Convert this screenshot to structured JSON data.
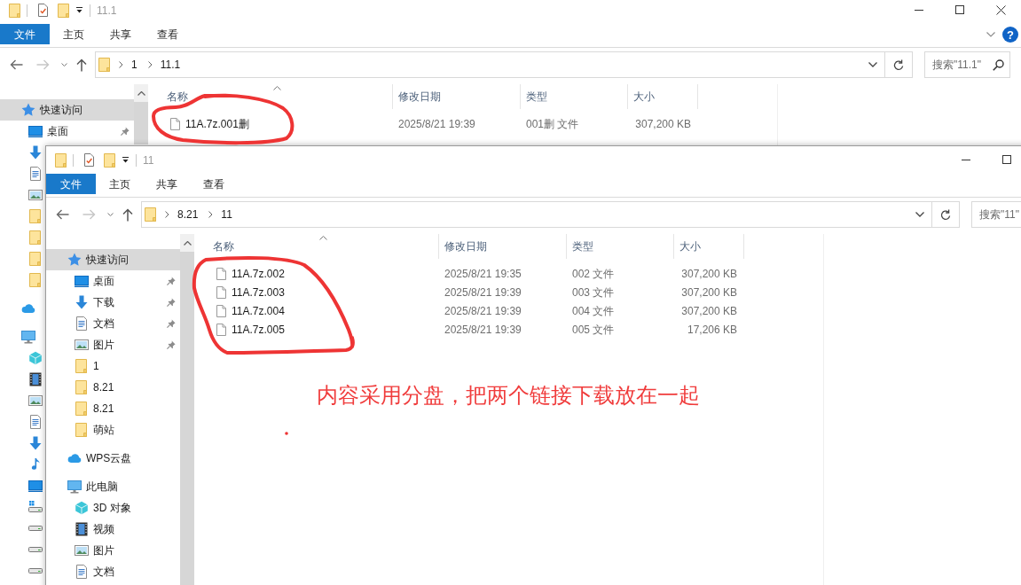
{
  "windows": [
    {
      "title": "11.1",
      "window_buttons": [
        {
          "kind": "minimize"
        },
        {
          "kind": "maximize"
        },
        {
          "kind": "close"
        }
      ],
      "ribbon_tabs": [
        {
          "label": "文件",
          "kind": "file_menu"
        },
        {
          "label": "主页",
          "kind": "tab"
        },
        {
          "label": "共享",
          "kind": "tab"
        },
        {
          "label": "查看",
          "kind": "tab"
        }
      ],
      "ribbon_toggle": true,
      "help_button": {
        "label": "?"
      },
      "navigation_buttons": [
        {
          "kind": "back",
          "disabled": false
        },
        {
          "kind": "forward",
          "disabled": true
        },
        {
          "kind": "recent_locations"
        },
        {
          "kind": "up",
          "disabled": false
        }
      ],
      "breadcrumb": [
        "1",
        "11.1"
      ],
      "search": {
        "placeholder": "搜索\"11.1\"",
        "icon_visible": true
      },
      "navigation_pane": [
        {
          "kind": "quick_access",
          "label": "快速访问",
          "selected": true,
          "children": [
            {
              "kind": "desktop",
              "label": "桌面",
              "selected": false,
              "pinned": true
            },
            {
              "kind": "downloads",
              "selected": false
            },
            {
              "kind": "documents",
              "selected": false
            },
            {
              "kind": "pictures",
              "selected": false
            },
            {
              "kind": "folder",
              "selected": false
            },
            {
              "kind": "folder",
              "selected": false
            },
            {
              "kind": "folder",
              "selected": false
            },
            {
              "kind": "folder",
              "selected": false
            }
          ]
        },
        {
          "kind": "wps_cloud",
          "selected": false
        },
        {
          "kind": "this_pc",
          "selected": false,
          "children": [
            {
              "kind": "objects_3d",
              "selected": false
            },
            {
              "kind": "videos",
              "selected": false
            },
            {
              "kind": "pictures",
              "selected": false
            },
            {
              "kind": "documents",
              "selected": false
            },
            {
              "kind": "downloads",
              "selected": false
            },
            {
              "kind": "music",
              "selected": false
            },
            {
              "kind": "desktop",
              "selected": false
            },
            {
              "kind": "system_drive",
              "selected": false
            },
            {
              "kind": "drive",
              "selected": false
            },
            {
              "kind": "drive",
              "selected": false
            },
            {
              "kind": "drive",
              "selected": false
            }
          ]
        }
      ],
      "columns": [
        {
          "label": "名称",
          "sorted": true
        },
        {
          "label": "修改日期",
          "sorted": false
        },
        {
          "label": "类型",
          "sorted": false
        },
        {
          "label": "大小",
          "sorted": false
        }
      ],
      "files": [
        {
          "name": "11A.7z.001删",
          "modified": "2025/8/21 19:39",
          "type": "001删 文件",
          "size": "307,200 KB"
        }
      ]
    },
    {
      "title": "11",
      "window_buttons": [
        {
          "kind": "minimize"
        },
        {
          "kind": "maximize"
        }
      ],
      "ribbon_tabs": [
        {
          "label": "文件",
          "kind": "file_menu"
        },
        {
          "label": "主页",
          "kind": "tab"
        },
        {
          "label": "共享",
          "kind": "tab"
        },
        {
          "label": "查看",
          "kind": "tab"
        }
      ],
      "navigation_buttons": [
        {
          "kind": "back",
          "disabled": false
        },
        {
          "kind": "forward",
          "disabled": true
        },
        {
          "kind": "recent_locations"
        },
        {
          "kind": "up",
          "disabled": false
        }
      ],
      "breadcrumb": [
        "8.21",
        "11"
      ],
      "search": {
        "placeholder": "搜索\"11\""
      },
      "navigation_pane": [
        {
          "kind": "quick_access",
          "label": "快速访问",
          "selected": true,
          "children": [
            {
              "kind": "desktop",
              "label": "桌面",
              "selected": false,
              "pinned": true
            },
            {
              "kind": "downloads",
              "label": "下载",
              "selected": false,
              "pinned": true
            },
            {
              "kind": "documents",
              "label": "文档",
              "selected": false,
              "pinned": true
            },
            {
              "kind": "pictures",
              "label": "图片",
              "selected": false,
              "pinned": true
            },
            {
              "kind": "folder",
              "label": "1",
              "selected": false,
              "pinned": false
            },
            {
              "kind": "folder",
              "label": "8.21",
              "selected": false,
              "pinned": false
            },
            {
              "kind": "folder",
              "label": "8.21",
              "selected": false,
              "pinned": false
            },
            {
              "kind": "folder",
              "label": "萌站",
              "selected": false,
              "pinned": false
            }
          ]
        },
        {
          "kind": "wps_cloud",
          "label": "WPS云盘",
          "selected": false
        },
        {
          "kind": "this_pc",
          "label": "此电脑",
          "selected": false,
          "children": [
            {
              "kind": "objects_3d",
              "label": "3D 对象",
              "selected": false
            },
            {
              "kind": "videos",
              "label": "视频",
              "selected": false
            },
            {
              "kind": "pictures",
              "label": "图片",
              "selected": false
            },
            {
              "kind": "documents",
              "label": "文档",
              "selected": false
            }
          ]
        }
      ],
      "columns": [
        {
          "label": "名称",
          "sorted": true
        },
        {
          "label": "修改日期",
          "sorted": false
        },
        {
          "label": "类型",
          "sorted": false
        },
        {
          "label": "大小",
          "sorted": false
        }
      ],
      "files": [
        {
          "name": "11A.7z.002",
          "modified": "2025/8/21 19:35",
          "type": "002 文件",
          "size": "307,200 KB"
        },
        {
          "name": "11A.7z.003",
          "modified": "2025/8/21 19:39",
          "type": "003 文件",
          "size": "307,200 KB"
        },
        {
          "name": "11A.7z.004",
          "modified": "2025/8/21 19:39",
          "type": "004 文件",
          "size": "307,200 KB"
        },
        {
          "name": "11A.7z.005",
          "modified": "2025/8/21 19:39",
          "type": "005 文件",
          "size": "17,206 KB"
        }
      ]
    }
  ],
  "annotations": [
    {
      "kind": "loop"
    },
    {
      "kind": "loop"
    },
    {
      "kind": "note",
      "text": "内容采用分盘，把两个链接下载放在一起"
    },
    {
      "kind": "dot"
    }
  ]
}
